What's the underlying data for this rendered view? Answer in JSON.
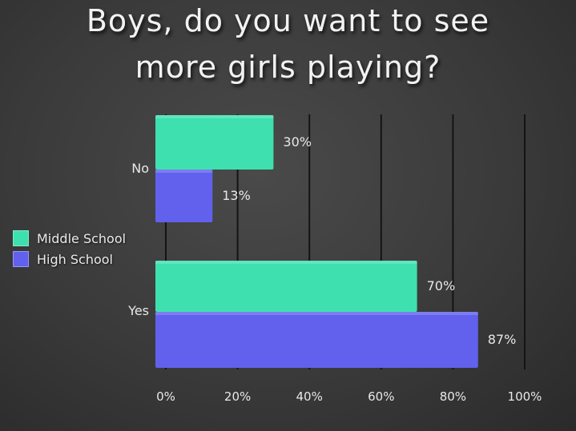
{
  "title_lines": [
    "Boys, do you want to see",
    "more girls playing?"
  ],
  "legend": {
    "middle_school": "Middle School",
    "high_school": "High School"
  },
  "colors": {
    "middle_school": "#3ee0b0",
    "high_school": "#6161ee",
    "background": "#3a3a3a",
    "gridline": "#141414",
    "text": "#e8e8e8"
  },
  "chart_data": {
    "type": "bar",
    "orientation": "horizontal",
    "title": "Boys, do you want to see more girls playing?",
    "categories": [
      "No",
      "Yes"
    ],
    "series": [
      {
        "name": "Middle School",
        "values": [
          30,
          70
        ],
        "labels": [
          "30%",
          "70%"
        ]
      },
      {
        "name": "High School",
        "values": [
          13,
          87
        ],
        "labels": [
          "13%",
          "87%"
        ]
      }
    ],
    "xlim": [
      0,
      100
    ],
    "xticks": [
      0,
      20,
      40,
      60,
      80,
      100
    ],
    "xtick_labels": [
      "0%",
      "20%",
      "40%",
      "60%",
      "80%",
      "100%"
    ],
    "grid": "vertical",
    "legend_position": "left",
    "xlabel": "",
    "ylabel": ""
  }
}
